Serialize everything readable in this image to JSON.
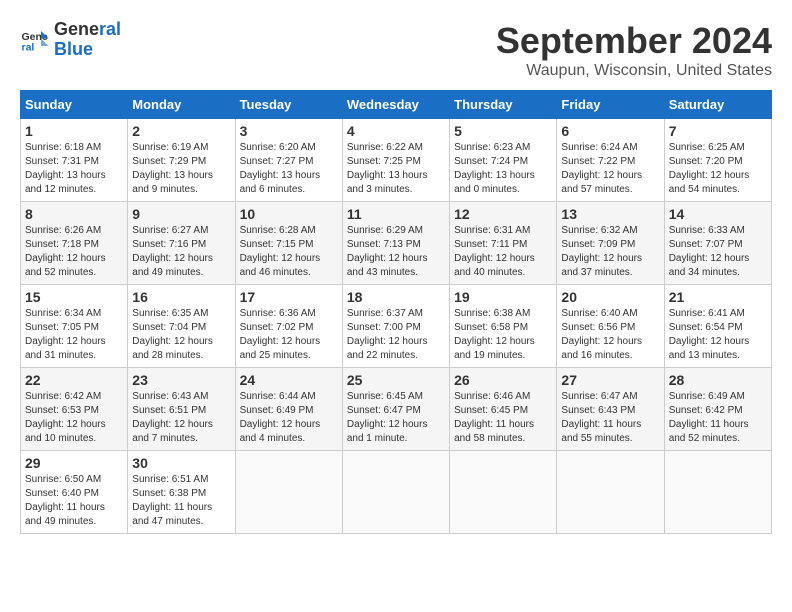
{
  "logo": {
    "line1": "General",
    "line2": "Blue"
  },
  "title": "September 2024",
  "subtitle": "Waupun, Wisconsin, United States",
  "days_of_week": [
    "Sunday",
    "Monday",
    "Tuesday",
    "Wednesday",
    "Thursday",
    "Friday",
    "Saturday"
  ],
  "weeks": [
    [
      {
        "day": "1",
        "sunrise": "6:18 AM",
        "sunset": "7:31 PM",
        "daylight": "13 hours and 12 minutes."
      },
      {
        "day": "2",
        "sunrise": "6:19 AM",
        "sunset": "7:29 PM",
        "daylight": "13 hours and 9 minutes."
      },
      {
        "day": "3",
        "sunrise": "6:20 AM",
        "sunset": "7:27 PM",
        "daylight": "13 hours and 6 minutes."
      },
      {
        "day": "4",
        "sunrise": "6:22 AM",
        "sunset": "7:25 PM",
        "daylight": "13 hours and 3 minutes."
      },
      {
        "day": "5",
        "sunrise": "6:23 AM",
        "sunset": "7:24 PM",
        "daylight": "13 hours and 0 minutes."
      },
      {
        "day": "6",
        "sunrise": "6:24 AM",
        "sunset": "7:22 PM",
        "daylight": "12 hours and 57 minutes."
      },
      {
        "day": "7",
        "sunrise": "6:25 AM",
        "sunset": "7:20 PM",
        "daylight": "12 hours and 54 minutes."
      }
    ],
    [
      {
        "day": "8",
        "sunrise": "6:26 AM",
        "sunset": "7:18 PM",
        "daylight": "12 hours and 52 minutes."
      },
      {
        "day": "9",
        "sunrise": "6:27 AM",
        "sunset": "7:16 PM",
        "daylight": "12 hours and 49 minutes."
      },
      {
        "day": "10",
        "sunrise": "6:28 AM",
        "sunset": "7:15 PM",
        "daylight": "12 hours and 46 minutes."
      },
      {
        "day": "11",
        "sunrise": "6:29 AM",
        "sunset": "7:13 PM",
        "daylight": "12 hours and 43 minutes."
      },
      {
        "day": "12",
        "sunrise": "6:31 AM",
        "sunset": "7:11 PM",
        "daylight": "12 hours and 40 minutes."
      },
      {
        "day": "13",
        "sunrise": "6:32 AM",
        "sunset": "7:09 PM",
        "daylight": "12 hours and 37 minutes."
      },
      {
        "day": "14",
        "sunrise": "6:33 AM",
        "sunset": "7:07 PM",
        "daylight": "12 hours and 34 minutes."
      }
    ],
    [
      {
        "day": "15",
        "sunrise": "6:34 AM",
        "sunset": "7:05 PM",
        "daylight": "12 hours and 31 minutes."
      },
      {
        "day": "16",
        "sunrise": "6:35 AM",
        "sunset": "7:04 PM",
        "daylight": "12 hours and 28 minutes."
      },
      {
        "day": "17",
        "sunrise": "6:36 AM",
        "sunset": "7:02 PM",
        "daylight": "12 hours and 25 minutes."
      },
      {
        "day": "18",
        "sunrise": "6:37 AM",
        "sunset": "7:00 PM",
        "daylight": "12 hours and 22 minutes."
      },
      {
        "day": "19",
        "sunrise": "6:38 AM",
        "sunset": "6:58 PM",
        "daylight": "12 hours and 19 minutes."
      },
      {
        "day": "20",
        "sunrise": "6:40 AM",
        "sunset": "6:56 PM",
        "daylight": "12 hours and 16 minutes."
      },
      {
        "day": "21",
        "sunrise": "6:41 AM",
        "sunset": "6:54 PM",
        "daylight": "12 hours and 13 minutes."
      }
    ],
    [
      {
        "day": "22",
        "sunrise": "6:42 AM",
        "sunset": "6:53 PM",
        "daylight": "12 hours and 10 minutes."
      },
      {
        "day": "23",
        "sunrise": "6:43 AM",
        "sunset": "6:51 PM",
        "daylight": "12 hours and 7 minutes."
      },
      {
        "day": "24",
        "sunrise": "6:44 AM",
        "sunset": "6:49 PM",
        "daylight": "12 hours and 4 minutes."
      },
      {
        "day": "25",
        "sunrise": "6:45 AM",
        "sunset": "6:47 PM",
        "daylight": "12 hours and 1 minute."
      },
      {
        "day": "26",
        "sunrise": "6:46 AM",
        "sunset": "6:45 PM",
        "daylight": "11 hours and 58 minutes."
      },
      {
        "day": "27",
        "sunrise": "6:47 AM",
        "sunset": "6:43 PM",
        "daylight": "11 hours and 55 minutes."
      },
      {
        "day": "28",
        "sunrise": "6:49 AM",
        "sunset": "6:42 PM",
        "daylight": "11 hours and 52 minutes."
      }
    ],
    [
      {
        "day": "29",
        "sunrise": "6:50 AM",
        "sunset": "6:40 PM",
        "daylight": "11 hours and 49 minutes."
      },
      {
        "day": "30",
        "sunrise": "6:51 AM",
        "sunset": "6:38 PM",
        "daylight": "11 hours and 47 minutes."
      },
      null,
      null,
      null,
      null,
      null
    ]
  ]
}
